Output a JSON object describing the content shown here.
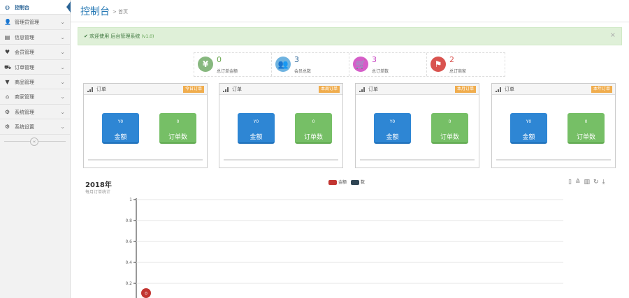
{
  "sidebar": {
    "items": [
      {
        "label": "控制台",
        "icon": "dashboard-icon",
        "glyph": "◍",
        "active": true
      },
      {
        "label": "管理员管理",
        "icon": "user-icon",
        "glyph": "👤",
        "active": false
      },
      {
        "label": "信息管理",
        "icon": "list-icon",
        "glyph": "▤",
        "active": false
      },
      {
        "label": "会员管理",
        "icon": "heart-icon",
        "glyph": "♥",
        "active": false
      },
      {
        "label": "订单管理",
        "icon": "cart-icon",
        "glyph": "⛟",
        "active": false
      },
      {
        "label": "商品管理",
        "icon": "filter-icon",
        "glyph": "▼",
        "active": false
      },
      {
        "label": "商家管理",
        "icon": "home-icon",
        "glyph": "⌂",
        "active": false
      },
      {
        "label": "系统管理",
        "icon": "gear-icon",
        "glyph": "⚙",
        "active": false
      },
      {
        "label": "系统设置",
        "icon": "cog-icon",
        "glyph": "⚙",
        "active": false
      }
    ],
    "collapse_glyph": "«"
  },
  "header": {
    "title": "控制台",
    "breadcrumb": "> 首页"
  },
  "alert": {
    "text": "✔ 欢迎使用 后台管理系统",
    "version": "(v1.0)",
    "close": "×"
  },
  "stats": [
    {
      "value": "0",
      "label": "总订单金额",
      "color": "#87b87f",
      "num_color": "#6aa84f",
      "glyph": "¥",
      "icon": "yen-icon"
    },
    {
      "value": "3",
      "label": "会员总数",
      "color": "#6fb3e0",
      "num_color": "#2a6496",
      "glyph": "👥",
      "icon": "users-icon"
    },
    {
      "value": "3",
      "label": "总订单数",
      "color": "#d55ec9",
      "num_color": "#c63dc0",
      "glyph": "🛒",
      "icon": "cart-icon"
    },
    {
      "value": "2",
      "label": "总订商家",
      "color": "#d9534f",
      "num_color": "#d9534f",
      "glyph": "⚑",
      "icon": "flag-icon"
    }
  ],
  "cards": [
    {
      "title": "订单",
      "badge": "今日订单",
      "amount_value": "Y0",
      "amount_label": "金额",
      "count_value": "0",
      "count_label": "订单数"
    },
    {
      "title": "订单",
      "badge": "本周订单",
      "amount_value": "Y0",
      "amount_label": "金额",
      "count_value": "0",
      "count_label": "订单数"
    },
    {
      "title": "订单",
      "badge": "本月订单",
      "amount_value": "Y0",
      "amount_label": "金额",
      "count_value": "0",
      "count_label": "订单数"
    },
    {
      "title": "订单",
      "badge": "本年订单",
      "amount_value": "Y0",
      "amount_label": "金额",
      "count_value": "0",
      "count_label": "订单数"
    }
  ],
  "chart": {
    "year": "2018年",
    "subtitle": "每月订单统计",
    "toolbox": [
      "▯",
      "≙",
      "▥",
      "↻",
      "⤓"
    ]
  },
  "chart_data": {
    "type": "line",
    "title": "2018年",
    "subtitle": "每月订单统计",
    "series": [
      {
        "name": "金额",
        "color": "#c23531",
        "values": [
          0
        ]
      },
      {
        "name": "数",
        "color": "#2f4554",
        "values": [
          0
        ]
      }
    ],
    "ylim": [
      0,
      1
    ],
    "yticks": [
      "1",
      "0.8",
      "0.6",
      "0.4",
      "0.2"
    ],
    "grid": true,
    "legend": "top-center",
    "point_label": "0"
  }
}
